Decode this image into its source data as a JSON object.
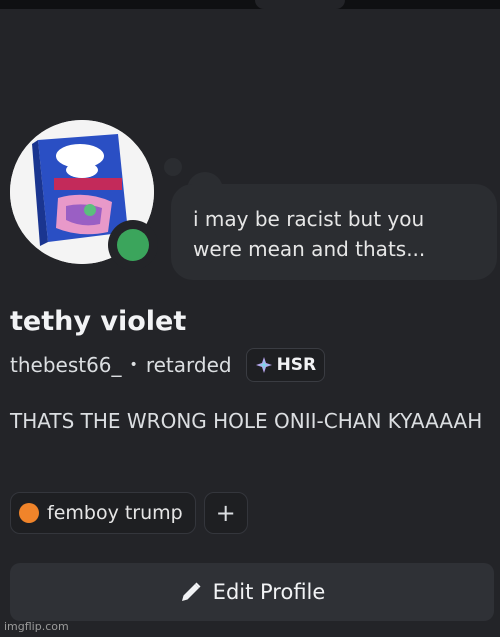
{
  "profile": {
    "display_name": "tethy violet",
    "username": "thebest66_",
    "separator": "•",
    "pronoun_tag": "retarded",
    "game_badge": "HSR",
    "status_bubble": "i may be racist but you were mean and thats...",
    "bio": "THATS THE WRONG HOLE ONII-CHAN KYAAAAH",
    "online_color": "#3ba55c"
  },
  "avatar": {
    "brand": "pop tarts",
    "flavor": "WILD BERRY",
    "small_text": "FROSTED"
  },
  "roles": [
    {
      "label": "femboy trump",
      "color": "#f0842a"
    }
  ],
  "add_role_label": "+",
  "edit_button": {
    "label": "Edit Profile"
  },
  "watermark": "imgflip.com"
}
